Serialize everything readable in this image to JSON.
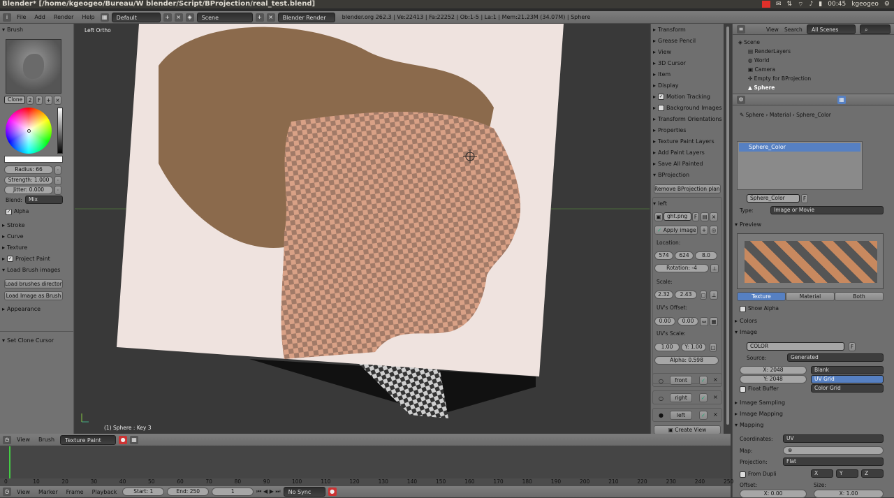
{
  "title": "Blender* [/home/kgeogeo/Bureau/W blender/Script/BProjection/real_test.blend]",
  "system": {
    "time": "00:45",
    "user": "kgeogeo",
    "icons": [
      "mail-icon",
      "wifi-icon",
      "volume-icon",
      "battery-icon"
    ]
  },
  "info_header": {
    "menus": [
      "File",
      "Add",
      "Render",
      "Help"
    ],
    "screen_layout": "Default",
    "scene": "Scene",
    "engine": "Blender Render",
    "stats": "blender.org 262.3 | Ve:22413 | Fa:22252 | Ob:1-5 | La:1 | Mem:21.23M (34.07M) | Sphere"
  },
  "tool_panel": {
    "brush_header": "Brush",
    "brush_name": "Clone",
    "brush_users": "2",
    "brush_fake": "F",
    "radius": "Radius: 66",
    "strength": "Strength: 1.000",
    "jitter": "Jitter: 0.000",
    "blend_label": "Blend:",
    "blend_value": "Mix",
    "alpha": "Alpha",
    "sections": [
      "Stroke",
      "Curve",
      "Texture",
      "Project Paint",
      "Load Brush images"
    ],
    "load_dir": "Load brushes directory",
    "load_image": "Load Image as Brush",
    "appearance": "Appearance",
    "set_clone": "Set Clone Cursor"
  },
  "viewport": {
    "view_label": "Left Ortho",
    "status": "(1) Sphere : Key 3"
  },
  "n_panel": {
    "sections": [
      "Transform",
      "Grease Pencil",
      "View",
      "3D Cursor",
      "Item",
      "Display",
      "Motion Tracking",
      "Background Images",
      "Transform Orientations",
      "Properties",
      "Texture Paint Layers",
      "Add Paint Layers",
      "Save All Painted",
      "BProjection"
    ],
    "remove_plane": "Remove BProjection plane",
    "sub_left": "left",
    "image_file": "ght.png",
    "image_fake": "F",
    "apply_image": "Apply image",
    "location_label": "Location:",
    "loc": [
      "574",
      "624",
      "8.0"
    ],
    "rotation": "Rotation: -4",
    "scale_label": "Scale:",
    "scale": [
      "2.32",
      "2.43"
    ],
    "uv_offset_label": "UV's Offset:",
    "uv_offset": [
      "0.00",
      "0.00"
    ],
    "uv_scale_label": "UV's Scale:",
    "uv_scale": [
      "1.00",
      "Y: 1.00"
    ],
    "alpha": "Alpha: 0.598",
    "views": [
      "front",
      "right",
      "left"
    ],
    "create_view": "Create View"
  },
  "outliner": {
    "menus": [
      "View",
      "Search"
    ],
    "filter": "All Scenes",
    "tree": [
      "Scene",
      "RenderLayers",
      "World",
      "Camera",
      "Empty for BProjection",
      "Sphere"
    ]
  },
  "properties": {
    "breadcrumb": [
      "Sphere",
      "Material",
      "Sphere_Color"
    ],
    "texture_slot": "Sphere_Color",
    "texture_name": "Sphere_Color",
    "texture_fake": "F",
    "type_label": "Type:",
    "type_value": "Image or Movie",
    "preview_label": "Preview",
    "preview_tabs": [
      "Texture",
      "Material",
      "Both"
    ],
    "show_alpha": "Show Alpha",
    "colors": "Colors",
    "image": "Image",
    "image_name": "COLOR",
    "image_fake": "F",
    "source_label": "Source:",
    "source_value": "Generated",
    "x_size": "X: 2048",
    "y_size": "Y: 2048",
    "gen_types": [
      "Blank",
      "UV Grid",
      "Color Grid"
    ],
    "float_buffer": "Float Buffer",
    "image_sampling": "Image Sampling",
    "image_mapping": "Image Mapping",
    "mapping": "Mapping",
    "coordinates_label": "Coordinates:",
    "coordinates_value": "UV",
    "map_label": "Map:",
    "projection_label": "Projection:",
    "projection_value": "Flat",
    "from_dupli": "From Dupli",
    "axes": [
      "X",
      "Y",
      "Z"
    ],
    "offset_label": "Offset:",
    "size_label": "Size:",
    "offset_x": "X: 0.00",
    "size_x": "X: 1.00"
  },
  "timeline": {
    "menus": [
      "View",
      "Brush"
    ],
    "mode": "Texture Paint",
    "ticks": [
      "0",
      "10",
      "20",
      "30",
      "40",
      "50",
      "60",
      "70",
      "80",
      "90",
      "100",
      "110",
      "120",
      "130",
      "140",
      "150",
      "160",
      "170",
      "180",
      "190",
      "200",
      "210",
      "220",
      "230",
      "240",
      "250"
    ],
    "foot_menus": [
      "View",
      "Marker",
      "Frame",
      "Playback"
    ],
    "start": "Start: 1",
    "end": "End: 250",
    "current": "1",
    "sync": "No Sync"
  },
  "colors": {
    "accent": "#5680c2",
    "checker_a": "#d8d8d8",
    "checker_b": "#6a6a6a"
  }
}
